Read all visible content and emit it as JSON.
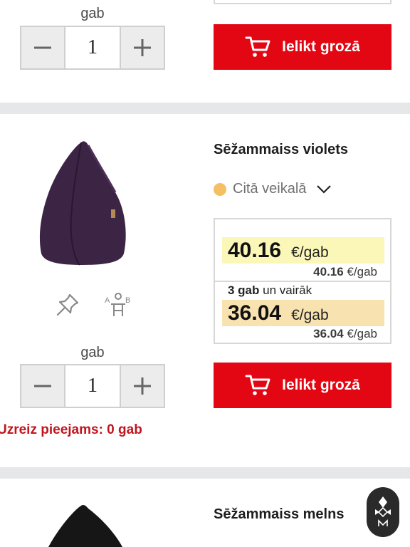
{
  "colors": {
    "accent_red": "#e30613",
    "availability_dot": "#f4c063",
    "price_highlight_1": "#fbf7b8",
    "price_highlight_2": "#f7e2b0",
    "note_red": "#c0151d"
  },
  "top_item": {
    "unit_label": "gab",
    "quantity": "1",
    "cart_label": "Ielikt grozā"
  },
  "product": {
    "title": "Sēžammaiss violets",
    "availability": "Citā veikalā",
    "price_main": "40.16",
    "price_main_unit": "€/gab",
    "price_main_sub_value": "40.16",
    "price_main_sub_unit": "€/gab",
    "tier_qty": "3 gab",
    "tier_text": "un vairāk",
    "price_tier": "36.04",
    "price_tier_unit": "€/gab",
    "price_tier_sub_value": "36.04",
    "price_tier_sub_unit": "€/gab",
    "unit_label": "gab",
    "quantity": "1",
    "cart_label": "Ielikt grozā",
    "stock_note": "Uzreiz pieejams: 0 gab",
    "icons": [
      "pin-icon",
      "compare-icon"
    ]
  },
  "next_product": {
    "title": "Sēžammaiss melns"
  }
}
